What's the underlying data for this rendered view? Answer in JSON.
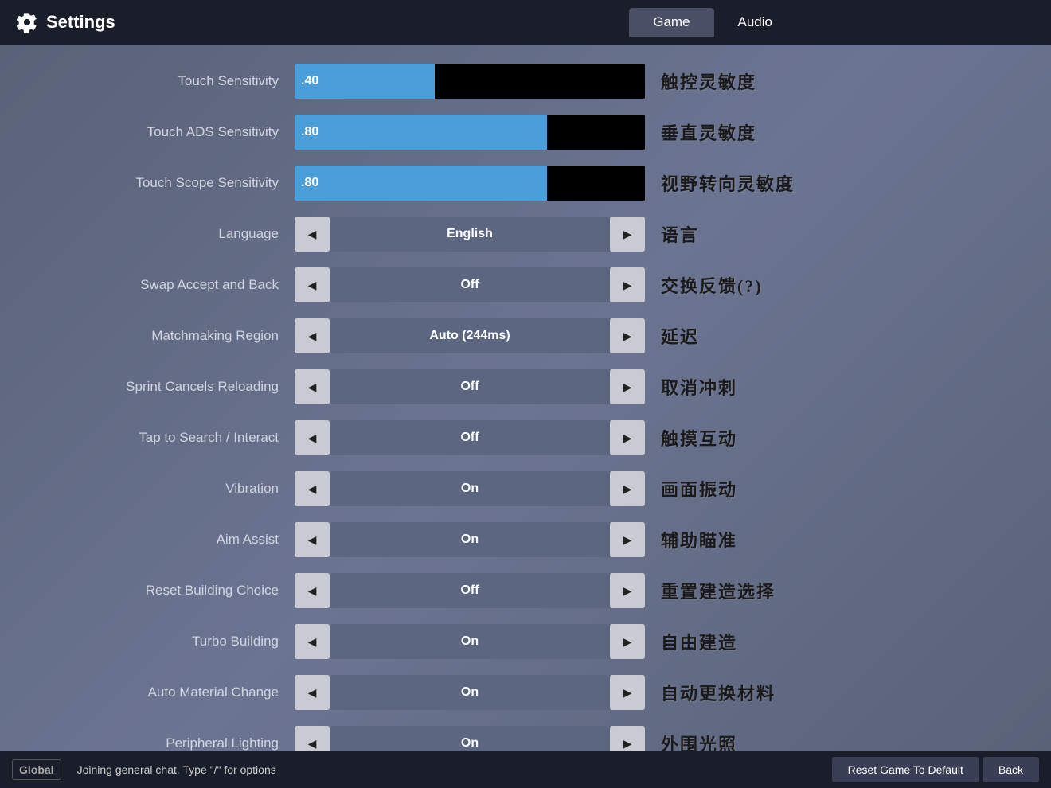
{
  "header": {
    "title": "Settings",
    "tabs": [
      {
        "label": "Game",
        "active": true
      },
      {
        "label": "Audio",
        "active": false
      }
    ]
  },
  "settings": {
    "rows": [
      {
        "id": "touch-sensitivity",
        "label": "Touch Sensitivity",
        "type": "slider",
        "value": ".40",
        "fill_pct": 40,
        "chinese": "触控灵敏度"
      },
      {
        "id": "touch-ads-sensitivity",
        "label": "Touch ADS Sensitivity",
        "type": "slider",
        "value": ".80",
        "fill_pct": 72,
        "chinese": "垂直灵敏度"
      },
      {
        "id": "touch-scope-sensitivity",
        "label": "Touch Scope Sensitivity",
        "type": "slider",
        "value": ".80",
        "fill_pct": 72,
        "chinese": "视野转向灵敏度"
      },
      {
        "id": "language",
        "label": "Language",
        "type": "arrow",
        "value": "English",
        "chinese": "语言"
      },
      {
        "id": "swap-accept-back",
        "label": "Swap Accept and Back",
        "type": "arrow",
        "value": "Off",
        "chinese": "交换反馈(?)"
      },
      {
        "id": "matchmaking-region",
        "label": "Matchmaking Region",
        "type": "arrow",
        "value": "Auto (244ms)",
        "chinese": "延迟"
      },
      {
        "id": "sprint-cancels-reloading",
        "label": "Sprint Cancels Reloading",
        "type": "arrow",
        "value": "Off",
        "chinese": "取消冲刺"
      },
      {
        "id": "tap-to-search",
        "label": "Tap to Search / Interact",
        "type": "arrow",
        "value": "Off",
        "chinese": "触摸互动"
      },
      {
        "id": "vibration",
        "label": "Vibration",
        "type": "arrow",
        "value": "On",
        "chinese": "画面振动"
      },
      {
        "id": "aim-assist",
        "label": "Aim Assist",
        "type": "arrow",
        "value": "On",
        "chinese": "辅助瞄准"
      },
      {
        "id": "reset-building-choice",
        "label": "Reset Building Choice",
        "type": "arrow",
        "value": "Off",
        "chinese": "重置建造选择"
      },
      {
        "id": "turbo-building",
        "label": "Turbo Building",
        "type": "arrow",
        "value": "On",
        "chinese": "自由建造"
      },
      {
        "id": "auto-material-change",
        "label": "Auto Material Change",
        "type": "arrow",
        "value": "On",
        "chinese": "自动更换材料"
      },
      {
        "id": "peripheral-lighting",
        "label": "Peripheral Lighting",
        "type": "arrow",
        "value": "On",
        "chinese": "外围光照"
      }
    ]
  },
  "footer": {
    "global_label": "Global",
    "chat_text": "Joining general chat. Type \"/\" for options",
    "reset_label": "Reset Game To Default",
    "back_label": "Back"
  }
}
